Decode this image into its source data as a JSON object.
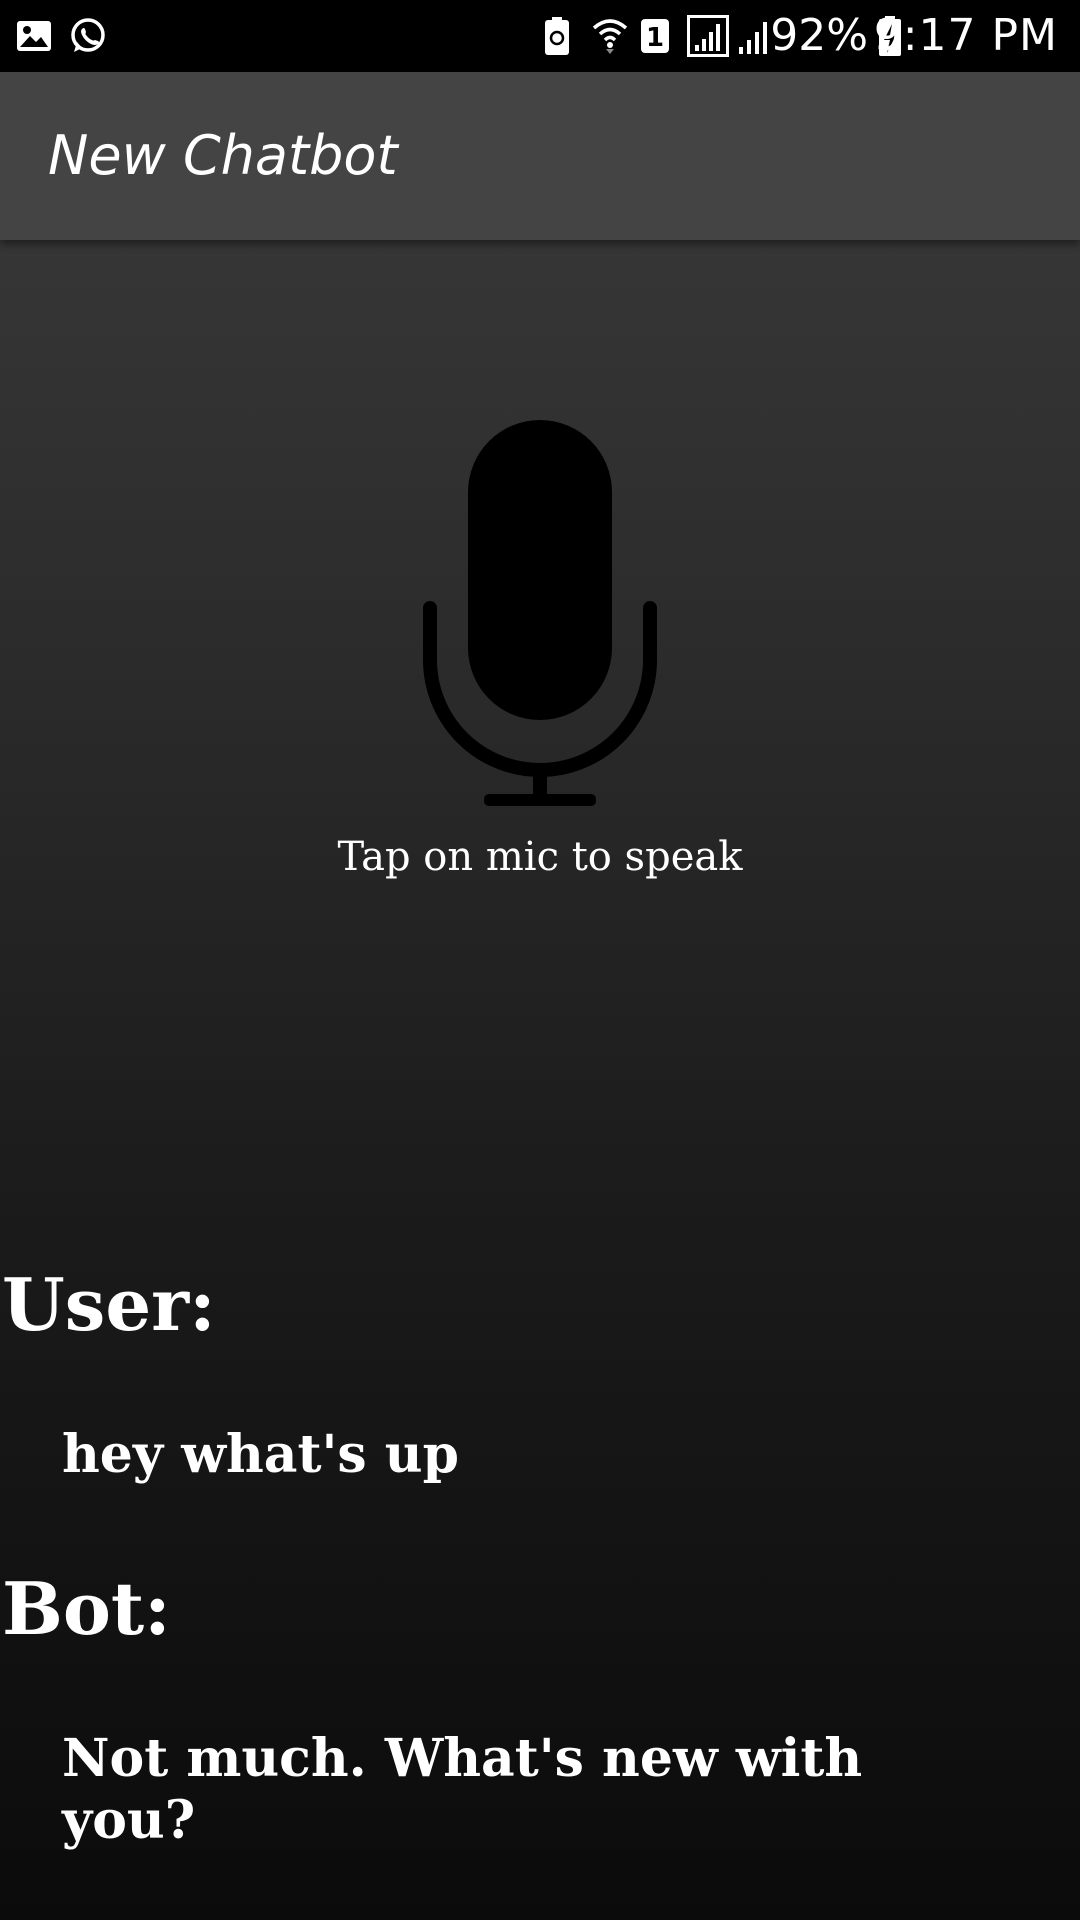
{
  "status_bar": {
    "left_icons": [
      "gallery-icon",
      "whatsapp-icon"
    ],
    "right_icons": [
      "battery-saver-icon",
      "wifi-icon",
      "sim-1-icon",
      "signal-icon",
      "signal-2-icon",
      "battery-charging-icon"
    ],
    "battery_percent": "92%",
    "time": "9:17 PM"
  },
  "app_bar": {
    "title": "New Chatbot",
    "background": "#444444"
  },
  "mic": {
    "icon": "microphone-icon",
    "hint": "Tap on mic to speak"
  },
  "conversation": {
    "user_label": "User:",
    "user_message": "hey what's up",
    "bot_label": "Bot:",
    "bot_message": "Not much. What's new with you?"
  }
}
